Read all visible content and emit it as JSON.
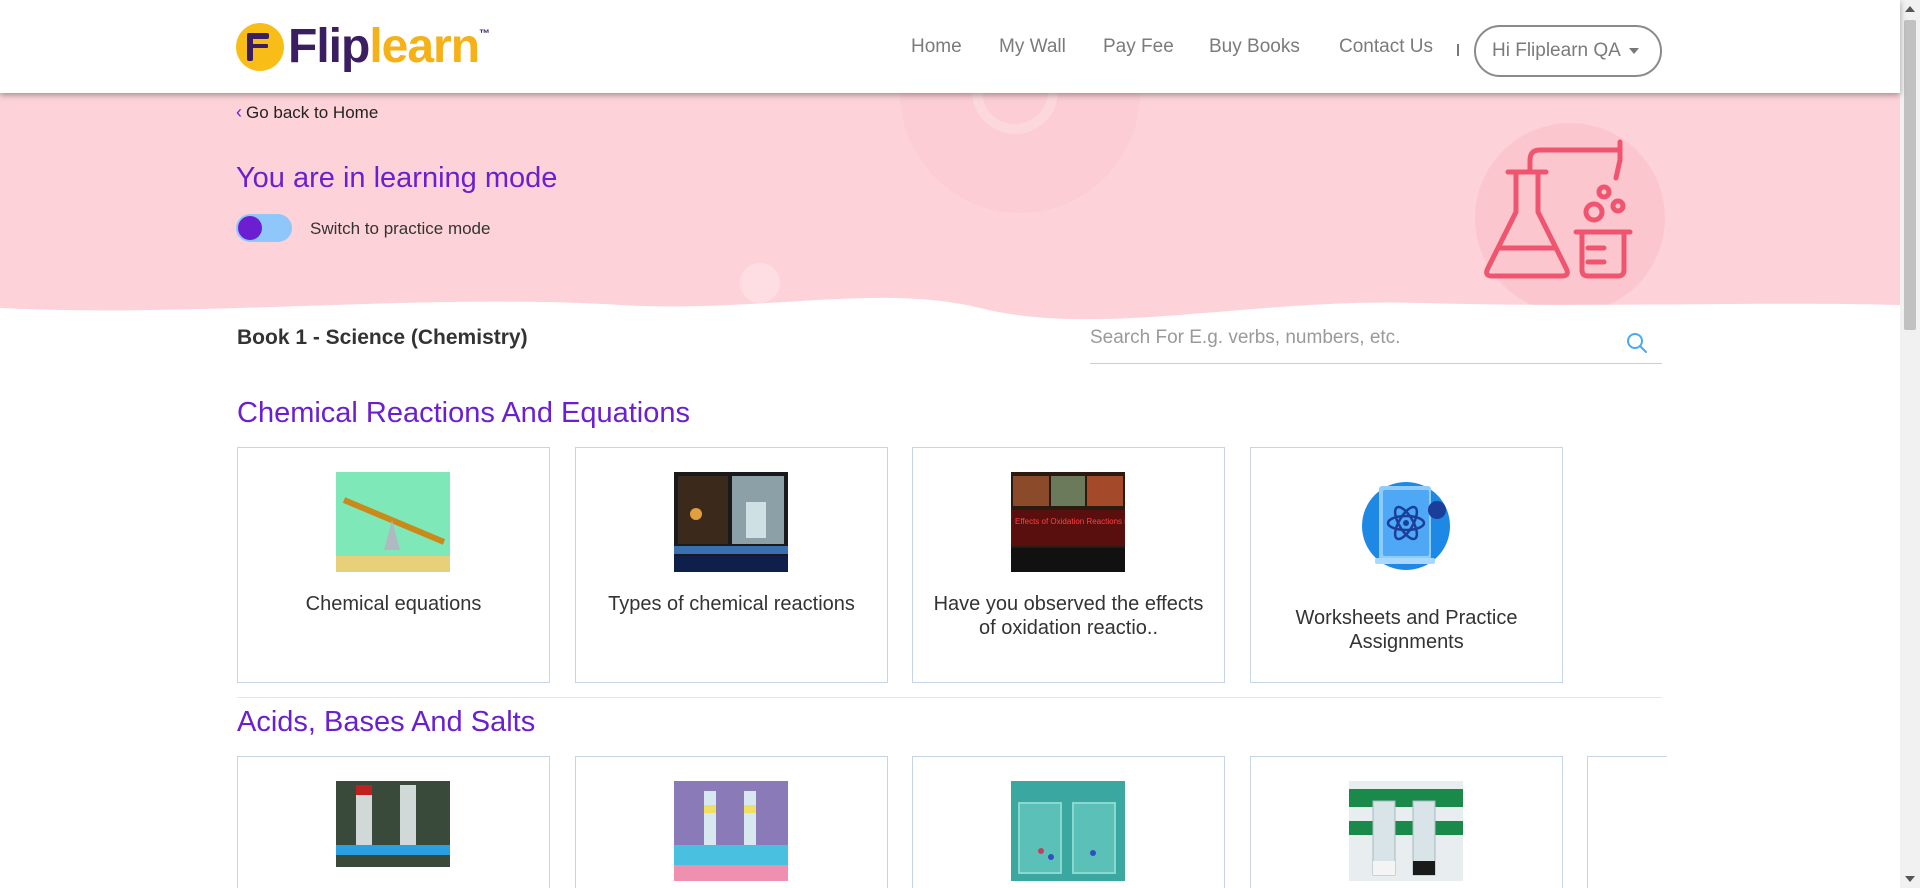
{
  "header": {
    "logo": {
      "part1": "Flip",
      "part2": "learn",
      "tm": "™"
    },
    "nav": [
      {
        "label": "Home"
      },
      {
        "label": "My Wall"
      },
      {
        "label": "Pay Fee"
      },
      {
        "label": "Buy Books"
      },
      {
        "label": "Contact Us"
      }
    ],
    "user_menu": {
      "label": "Hi Fliplearn QA"
    }
  },
  "banner": {
    "back_label": "Go back to Home",
    "mode_title": "You are in learning mode",
    "toggle_label": "Switch to practice mode",
    "colors": {
      "background": "#fdd3d9",
      "accent": "#6b1fd0",
      "toggle_track": "#8fc7fb",
      "illustration": "#f0556f"
    }
  },
  "book": {
    "title": "Book 1 - Science (Chemistry)",
    "search_placeholder": "Search For E.g. verbs, numbers, etc."
  },
  "sections": [
    {
      "title": "Chemical Reactions And Equations",
      "cards": [
        {
          "label": "Chemical equations",
          "icon": "seesaw-thumbnail"
        },
        {
          "label": "Types of chemical reactions",
          "icon": "lab-video-thumbnail"
        },
        {
          "label": "Have you observed the effects of oxidation reactio..",
          "icon": "rust-thumbnail",
          "thumb_text": "Effects of Oxidation Reactions in Daily Life"
        },
        {
          "label": "Worksheets and Practice Assignments",
          "icon": "atom-book-icon"
        }
      ]
    },
    {
      "title": "Acids, Bases And Salts",
      "cards": [
        {
          "label": "",
          "icon": "test-tube-thumbnail"
        },
        {
          "label": "",
          "icon": "test-tube-rack-thumbnail"
        },
        {
          "label": "",
          "icon": "beakers-thumbnail"
        },
        {
          "label": "",
          "icon": "beakers-dark-thumbnail"
        }
      ]
    }
  ]
}
